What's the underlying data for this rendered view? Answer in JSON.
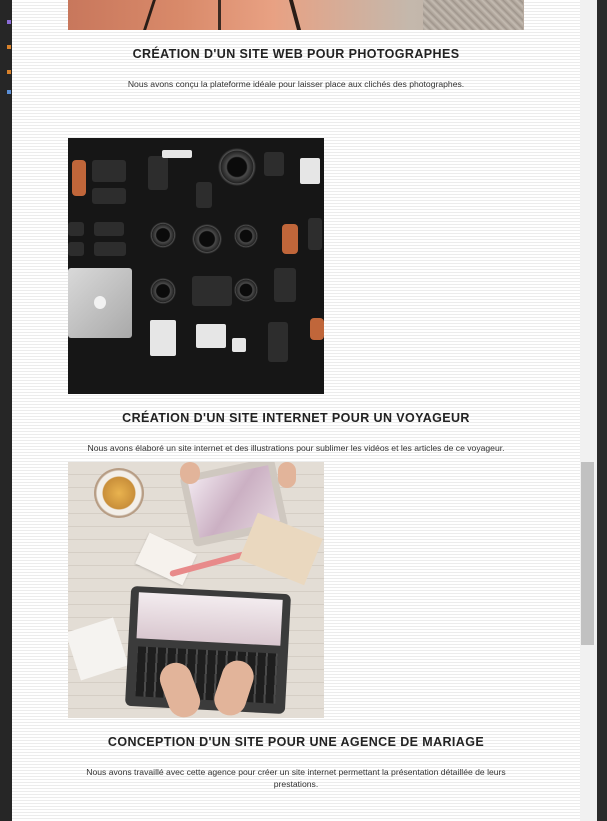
{
  "projects": [
    {
      "title": "CRÉATION D'UN SITE WEB POUR PHOTOGRAPHES",
      "description": "Nous avons conçu la plateforme idéale pour laisser place aux clichés des photographes."
    },
    {
      "title": "CRÉATION D'UN SITE INTERNET POUR UN VOYAGEUR",
      "description": "Nous avons élaboré un site internet et des illustrations pour sublimer les vidéos et les articles de ce voyageur."
    },
    {
      "title": "CONCEPTION D'UN SITE POUR UNE AGENCE DE MARIAGE",
      "description": "Nous avons travaillé avec cette agence pour créer un site internet permettant la présentation détaillée de leurs prestations."
    }
  ],
  "colors": {
    "page_background": "#fbfbfb",
    "title_text": "#222222",
    "scrollbar_track": "#f1f1f1",
    "scrollbar_thumb": "#c1c1c1",
    "window_frame": "#2b2b2b"
  }
}
